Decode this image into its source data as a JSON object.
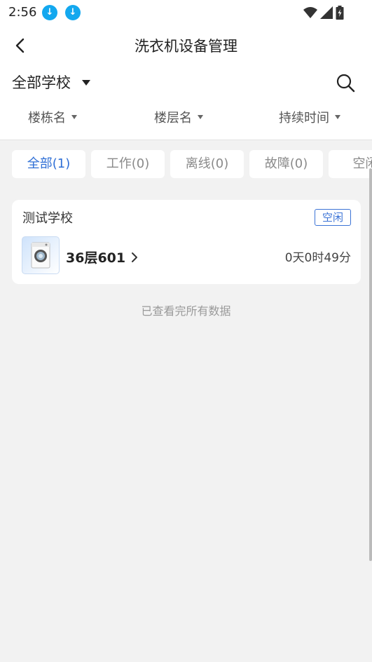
{
  "status_bar": {
    "time": "2:56",
    "icons": [
      "download-icon",
      "download-icon",
      "wifi-icon",
      "signal-icon",
      "battery-icon"
    ]
  },
  "nav": {
    "title": "洗衣机设备管理",
    "back_icon": "chevron-left-icon"
  },
  "school_selector": {
    "label": "全部学校",
    "caret_icon": "caret-down-icon",
    "search_icon": "search-icon"
  },
  "filters": [
    {
      "label": "楼栋名"
    },
    {
      "label": "楼层名"
    },
    {
      "label": "持续时间"
    }
  ],
  "tabs": [
    {
      "label": "全部(1)",
      "active": true
    },
    {
      "label": "工作(0)",
      "active": false
    },
    {
      "label": "离线(0)",
      "active": false
    },
    {
      "label": "故障(0)",
      "active": false
    },
    {
      "label": "空闲",
      "active": false
    }
  ],
  "devices": [
    {
      "school": "测试学校",
      "status": "空闲",
      "room": "36层601",
      "duration": "0天0时49分"
    }
  ],
  "footer": {
    "end_text": "已查看完所有数据"
  },
  "colors": {
    "accent": "#2f6fd6",
    "badge": "#3b73d6",
    "download": "#13a8ef",
    "background": "#f2f2f2"
  }
}
